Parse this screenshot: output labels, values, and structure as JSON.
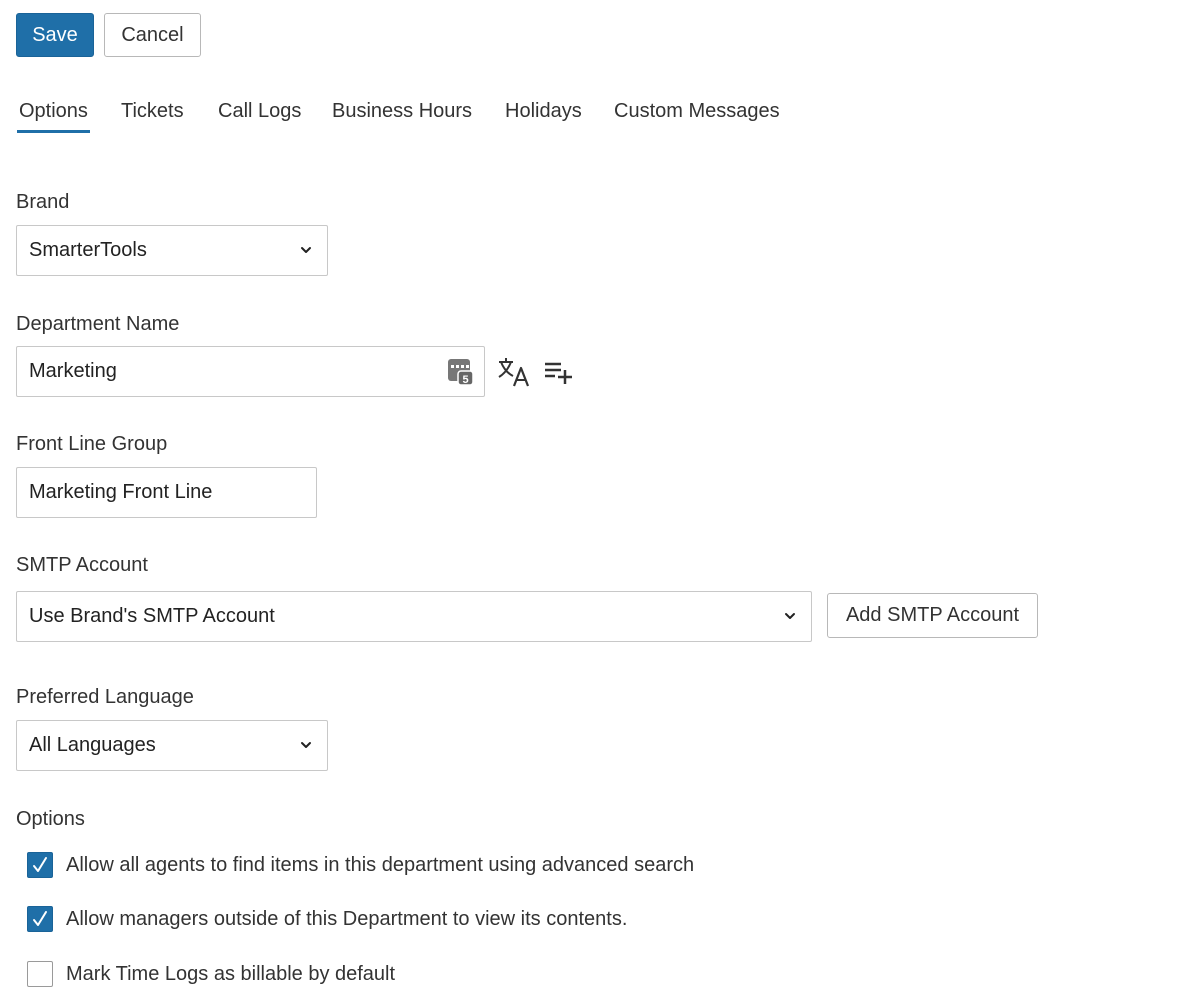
{
  "toolbar": {
    "save_label": "Save",
    "cancel_label": "Cancel",
    "accent_color": "#1f6fa8"
  },
  "tabs": [
    {
      "label": "Options",
      "active": true
    },
    {
      "label": "Tickets",
      "active": false
    },
    {
      "label": "Call Logs",
      "active": false
    },
    {
      "label": "Business Hours",
      "active": false
    },
    {
      "label": "Holidays",
      "active": false
    },
    {
      "label": "Custom Messages",
      "active": false
    }
  ],
  "form": {
    "brand": {
      "label": "Brand",
      "value": "SmarterTools"
    },
    "department_name": {
      "label": "Department Name",
      "value": "Marketing",
      "icons": [
        "password-manager-icon",
        "translate-icon",
        "add-list-icon"
      ]
    },
    "front_line_group": {
      "label": "Front Line Group",
      "value": "Marketing Front Line"
    },
    "smtp_account": {
      "label": "SMTP Account",
      "value": "Use Brand's SMTP Account",
      "add_button_label": "Add SMTP Account"
    },
    "preferred_language": {
      "label": "Preferred Language",
      "value": "All Languages"
    },
    "options": {
      "label": "Options",
      "items": [
        {
          "label": "Allow all agents to find items in this department using advanced search",
          "checked": true
        },
        {
          "label": "Allow managers outside of this Department to view its contents.",
          "checked": true
        },
        {
          "label": "Mark Time Logs as billable by default",
          "checked": false
        }
      ]
    }
  }
}
